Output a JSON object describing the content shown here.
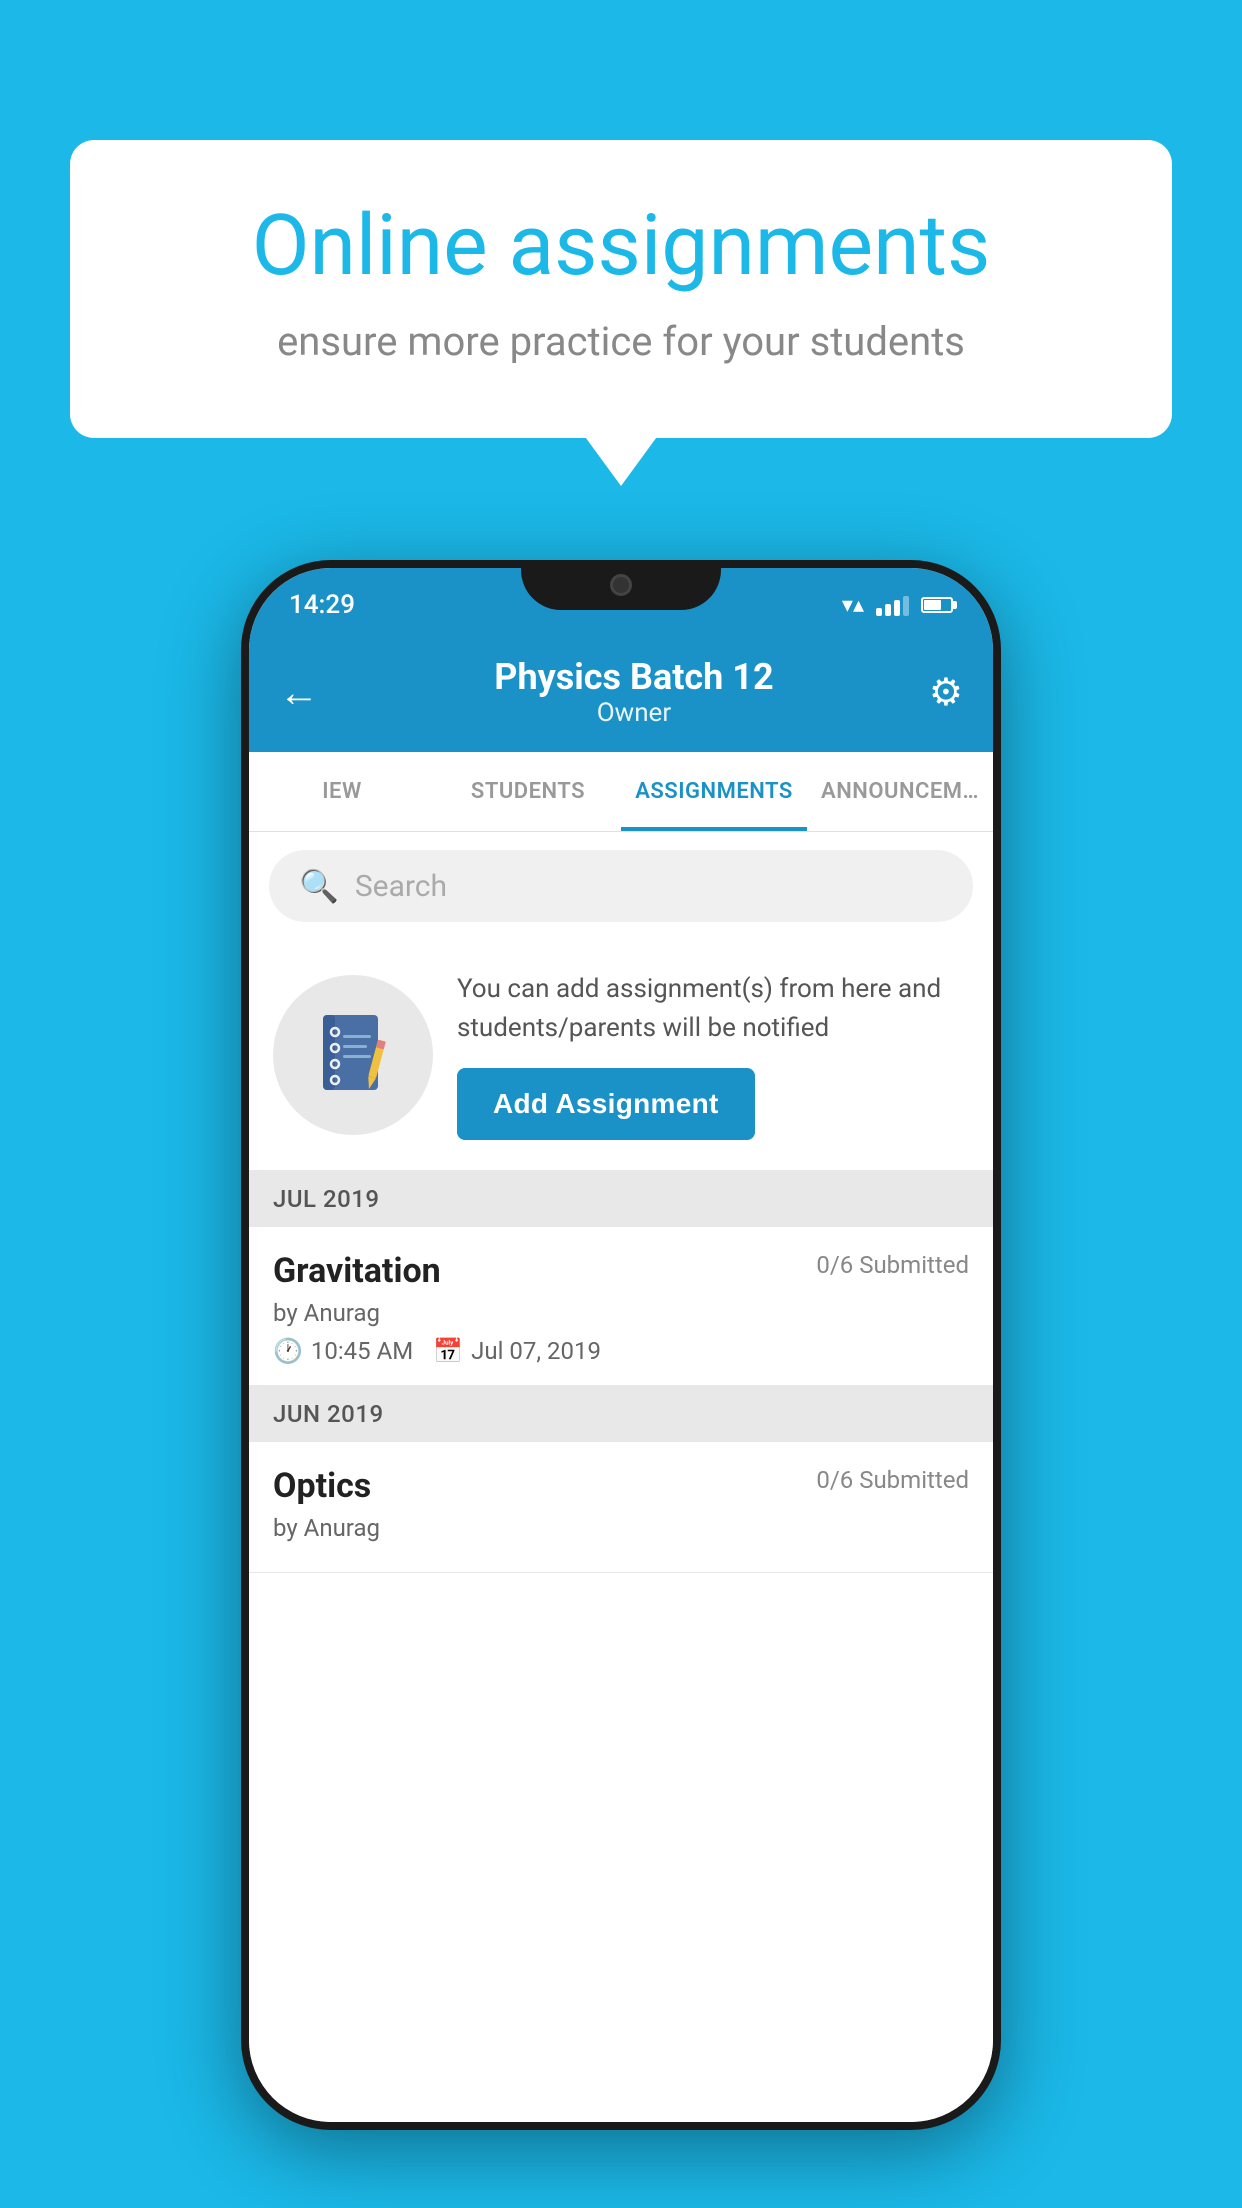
{
  "background": {
    "color": "#1bb8e8"
  },
  "speech_bubble": {
    "title": "Online assignments",
    "subtitle": "ensure more practice for your students"
  },
  "phone": {
    "status_bar": {
      "time": "14:29"
    },
    "header": {
      "title": "Physics Batch 12",
      "subtitle": "Owner",
      "back_label": "←",
      "settings_label": "⚙"
    },
    "tabs": [
      {
        "label": "IEW",
        "active": false
      },
      {
        "label": "STUDENTS",
        "active": false
      },
      {
        "label": "ASSIGNMENTS",
        "active": true
      },
      {
        "label": "ANNOUNCEM…",
        "active": false
      }
    ],
    "search": {
      "placeholder": "Search"
    },
    "promo": {
      "description": "You can add assignment(s) from here and students/parents will be notified",
      "button_label": "Add Assignment"
    },
    "sections": [
      {
        "label": "JUL 2019",
        "assignments": [
          {
            "title": "Gravitation",
            "submitted": "0/6 Submitted",
            "by": "by Anurag",
            "time": "10:45 AM",
            "date": "Jul 07, 2019"
          }
        ]
      },
      {
        "label": "JUN 2019",
        "assignments": [
          {
            "title": "Optics",
            "submitted": "0/6 Submitted",
            "by": "by Anurag",
            "time": "",
            "date": ""
          }
        ]
      }
    ]
  }
}
